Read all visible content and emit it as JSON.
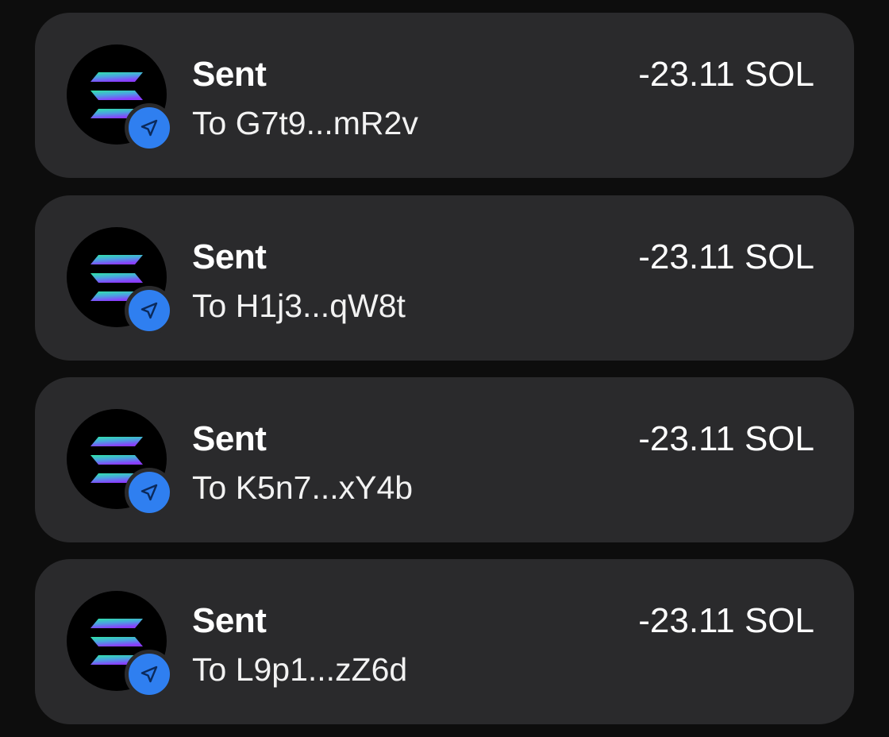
{
  "transactions": [
    {
      "title": "Sent",
      "recipient": "To G7t9...mR2v",
      "amount": "-23.11 SOL",
      "token_icon": "solana-logo-icon",
      "type_icon": "send-arrow-icon"
    },
    {
      "title": "Sent",
      "recipient": "To H1j3...qW8t",
      "amount": "-23.11 SOL",
      "token_icon": "solana-logo-icon",
      "type_icon": "send-arrow-icon"
    },
    {
      "title": "Sent",
      "recipient": "To K5n7...xY4b",
      "amount": "-23.11 SOL",
      "token_icon": "solana-logo-icon",
      "type_icon": "send-arrow-icon"
    },
    {
      "title": "Sent",
      "recipient": "To L9p1...zZ6d",
      "amount": "-23.11 SOL",
      "token_icon": "solana-logo-icon",
      "type_icon": "send-arrow-icon"
    }
  ],
  "colors": {
    "background": "#0d0d0d",
    "card": "#2a2a2c",
    "badge": "#2f7ff0",
    "solana_green": "#14f195",
    "solana_purple": "#9945ff"
  }
}
